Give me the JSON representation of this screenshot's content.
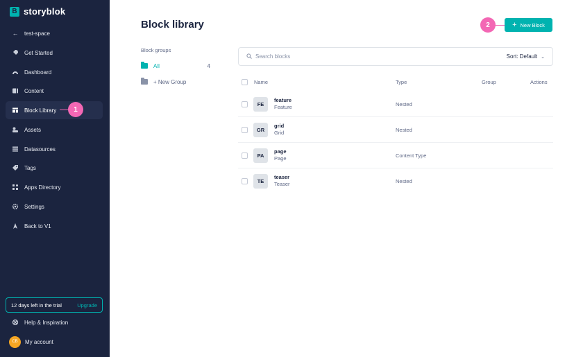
{
  "app": {
    "brand": "storyblok",
    "brand_logo_letter": "B"
  },
  "sidebar": {
    "space": {
      "label": "test-space",
      "icon": "arrow-left-icon"
    },
    "items": [
      {
        "label": "Get Started",
        "icon": "rocket-icon"
      },
      {
        "label": "Dashboard",
        "icon": "gauge-icon"
      },
      {
        "label": "Content",
        "icon": "content-icon"
      },
      {
        "label": "Block Library",
        "icon": "block-library-icon",
        "active": true
      },
      {
        "label": "Assets",
        "icon": "assets-icon"
      },
      {
        "label": "Datasources",
        "icon": "datasources-icon"
      },
      {
        "label": "Tags",
        "icon": "tag-icon"
      },
      {
        "label": "Apps Directory",
        "icon": "apps-icon"
      },
      {
        "label": "Settings",
        "icon": "gear-icon"
      },
      {
        "label": "Back to V1",
        "icon": "back-v1-icon"
      }
    ],
    "trial": {
      "text": "12 days left in the trial",
      "upgrade_label": "Upgrade"
    },
    "help": {
      "label": "Help & Inspiration",
      "icon": "help-icon"
    },
    "account": {
      "label": "My account",
      "avatar_initials": "CB",
      "avatar_color": "#f5a623"
    }
  },
  "callouts": {
    "one": "1",
    "two": "2",
    "color": "#f367b4"
  },
  "main": {
    "title": "Block library",
    "new_block_label": "New Block",
    "groups_heading": "Block groups",
    "groups": [
      {
        "label": "All",
        "count": "4",
        "active": true
      },
      {
        "label": "+ New Group",
        "count": ""
      }
    ],
    "search_placeholder": "Search blocks",
    "sort_label": "Sort: Default",
    "columns": {
      "name": "Name",
      "type": "Type",
      "group": "Group",
      "actions": "Actions"
    },
    "blocks": [
      {
        "abbr": "FE",
        "name": "feature",
        "display": "Feature",
        "type": "Nested"
      },
      {
        "abbr": "GR",
        "name": "grid",
        "display": "Grid",
        "type": "Nested"
      },
      {
        "abbr": "PA",
        "name": "page",
        "display": "Page",
        "type": "Content Type"
      },
      {
        "abbr": "TE",
        "name": "teaser",
        "display": "Teaser",
        "type": "Nested"
      }
    ]
  },
  "colors": {
    "sidebar_bg": "#1b243f",
    "accent": "#00b3b0",
    "text_dark": "#1b243f",
    "text_muted": "#5d6785"
  }
}
